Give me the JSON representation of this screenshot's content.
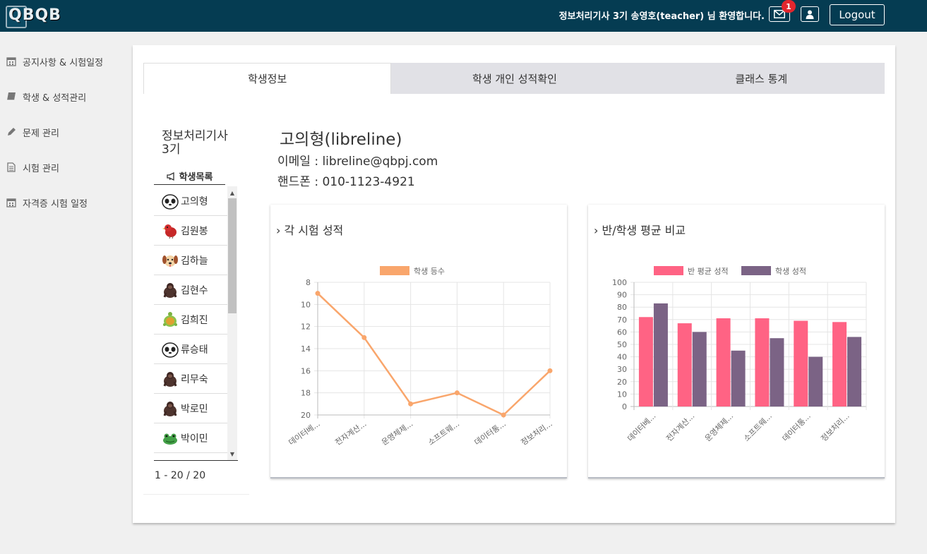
{
  "header": {
    "logo": "QBQB",
    "welcome": "정보처리기사 3기 송영호(teacher) 님 환영합니다.",
    "mail_badge": "1",
    "logout_label": "Logout"
  },
  "sidebar": {
    "items": [
      {
        "label": "공지사항 & 시험일정",
        "icon": "calendar-icon"
      },
      {
        "label": "학생 & 성적관리",
        "icon": "book-icon"
      },
      {
        "label": "문제 관리",
        "icon": "pencil-icon"
      },
      {
        "label": "시험 관리",
        "icon": "document-icon"
      },
      {
        "label": "자격증 시험 일정",
        "icon": "calendar-icon"
      }
    ]
  },
  "tabs": [
    {
      "label": "학생정보",
      "active": true
    },
    {
      "label": "학생 개인 성적확인",
      "active": false
    },
    {
      "label": "클래스 통계",
      "active": false
    }
  ],
  "class_panel": {
    "class_name": "정보처리기사 3기",
    "list_title": "학생목록",
    "pager": "1 - 20 / 20",
    "students": [
      {
        "name": "고의형",
        "avatar": "panda-icon"
      },
      {
        "name": "김원봉",
        "avatar": "bird-icon"
      },
      {
        "name": "김하늘",
        "avatar": "dog-icon"
      },
      {
        "name": "김현수",
        "avatar": "gorilla-icon"
      },
      {
        "name": "김희진",
        "avatar": "turtle-icon"
      },
      {
        "name": "류승태",
        "avatar": "panda-icon"
      },
      {
        "name": "리무숙",
        "avatar": "gorilla-icon"
      },
      {
        "name": "박로민",
        "avatar": "gorilla-icon"
      },
      {
        "name": "박이민",
        "avatar": "frog-icon"
      }
    ]
  },
  "student": {
    "name": "고의형(libreline)",
    "email": "이메일 : libreline@qbpj.com",
    "phone": "핸드폰 : 010-1123-4921"
  },
  "cards": {
    "left_title": "› 각 시험 성적",
    "right_title": "› 반/학생 평균 비교"
  },
  "chart_data": [
    {
      "type": "line",
      "title": "",
      "categories": [
        "데이터베...",
        "전자계산...",
        "운영체제...",
        "소프트웨...",
        "데이터통...",
        "정보처리..."
      ],
      "series": [
        {
          "name": "학생 등수",
          "values": [
            9,
            13,
            19,
            18,
            20,
            16
          ],
          "color": "#f9a66c"
        }
      ],
      "ylim": [
        8,
        20
      ],
      "y_reversed": true,
      "yticks": [
        8,
        10,
        12,
        14,
        16,
        18,
        20
      ],
      "grid": true,
      "legend": "top"
    },
    {
      "type": "bar",
      "title": "",
      "categories": [
        "데이터베...",
        "전자계산...",
        "운영체제...",
        "소프트웨...",
        "데이터통...",
        "정보처리..."
      ],
      "series": [
        {
          "name": "반 평균 성적",
          "values": [
            72,
            67,
            71,
            71,
            69,
            68
          ],
          "color": "#ff6384"
        },
        {
          "name": "학생 성적",
          "values": [
            83,
            60,
            45,
            55,
            40,
            56
          ],
          "color": "#7b6385"
        }
      ],
      "ylim": [
        0,
        100
      ],
      "yticks": [
        0,
        10,
        20,
        30,
        40,
        50,
        60,
        70,
        80,
        90,
        100
      ],
      "grid": true,
      "legend": "top"
    }
  ]
}
